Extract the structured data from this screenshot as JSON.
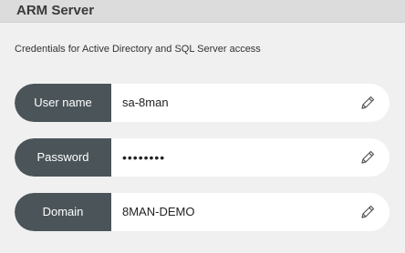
{
  "header": {
    "title": "ARM Server"
  },
  "description": "Credentials for Active Directory and SQL Server access",
  "fields": [
    {
      "label": "User name",
      "value": "sa-8man"
    },
    {
      "label": "Password",
      "value": "••••••••"
    },
    {
      "label": "Domain",
      "value": "8MAN-DEMO"
    }
  ],
  "icons": {
    "edit": "pencil-icon"
  },
  "colors": {
    "label_background": "#4a5459",
    "header_background": "#dcdcdc",
    "panel_background": "#f0f0f0"
  }
}
